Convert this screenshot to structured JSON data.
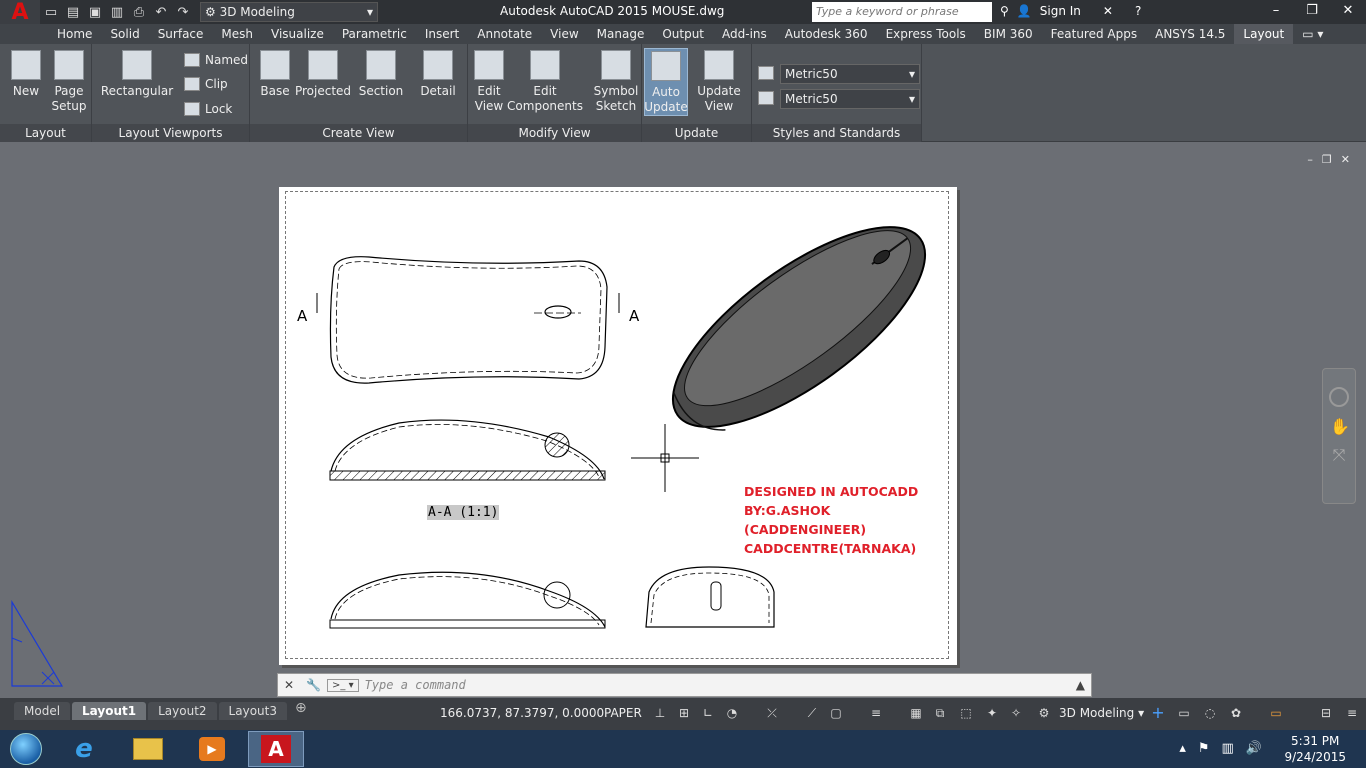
{
  "titlebar": {
    "workspace": "3D Modeling",
    "title": "Autodesk AutoCAD 2015    MOUSE.dwg",
    "search_placeholder": "Type a keyword or phrase",
    "sign_in": "Sign In"
  },
  "tabs": [
    "Home",
    "Solid",
    "Surface",
    "Mesh",
    "Visualize",
    "Parametric",
    "Insert",
    "Annotate",
    "View",
    "Manage",
    "Output",
    "Add-ins",
    "Autodesk 360",
    "Express Tools",
    "BIM 360",
    "Featured Apps",
    "ANSYS 14.5",
    "Layout"
  ],
  "ribbon": {
    "layout_panel": {
      "title": "Layout",
      "new": "New",
      "page_setup_1": "Page",
      "page_setup_2": "Setup"
    },
    "viewports_panel": {
      "title": "Layout Viewports",
      "rectangular": "Rectangular",
      "named": "Named",
      "clip": "Clip",
      "lock": "Lock"
    },
    "create_view_panel": {
      "title": "Create View",
      "base": "Base",
      "projected": "Projected",
      "section": "Section",
      "detail": "Detail"
    },
    "modify_view_panel": {
      "title": "Modify View",
      "edit_view_1": "Edit",
      "edit_view_2": "View",
      "edit_comp_1": "Edit",
      "edit_comp_2": "Components",
      "symbol_1": "Symbol",
      "symbol_2": "Sketch"
    },
    "update_panel": {
      "title": "Update",
      "auto_1": "Auto",
      "auto_2": "Update",
      "update_1": "Update",
      "update_2": "View"
    },
    "styles_panel": {
      "title": "Styles and Standards",
      "style1": "Metric50",
      "style2": "Metric50"
    }
  },
  "drawing": {
    "section_label": "A-A (1:1)",
    "cut_left": "A",
    "cut_right": "A",
    "note_lines": [
      "DESIGNED IN AUTOCADD",
      "BY:G.ASHOK",
      "(CADDENGINEER)",
      "CADDCENTRE(TARNAKA)"
    ]
  },
  "command": {
    "placeholder": "Type a command"
  },
  "statusbar": {
    "layout_tabs": [
      "Model",
      "Layout1",
      "Layout2",
      "Layout3"
    ],
    "active_tab": "Layout1",
    "coords": "166.0737, 87.3797, 0.0000",
    "space": "PAPER",
    "workspace": "3D Modeling"
  },
  "taskbar": {
    "time": "5:31 PM",
    "date": "9/24/2015"
  },
  "colors": {
    "accent_red": "#e0202a",
    "ribbon": "#505459",
    "canvas": "#6b6e74"
  }
}
